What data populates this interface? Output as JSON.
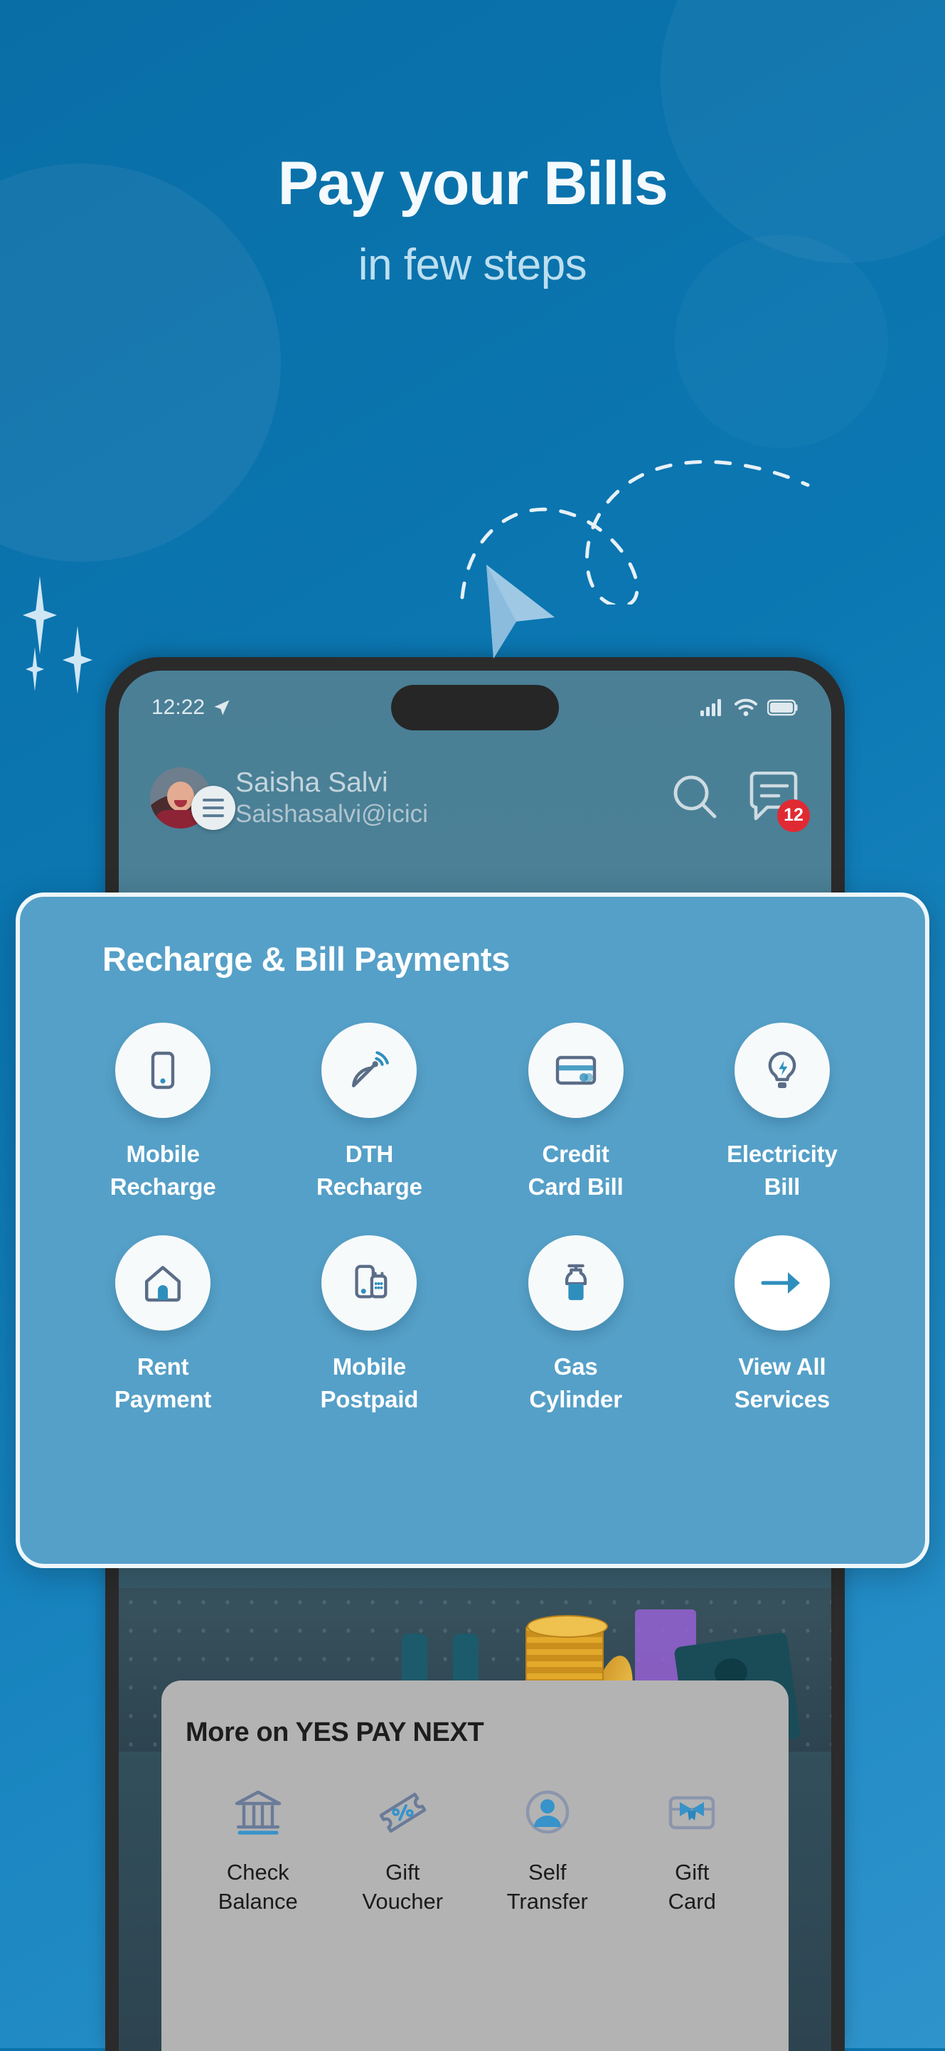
{
  "hero": {
    "headline": "Pay your Bills",
    "subhead": "in few steps"
  },
  "colors": {
    "background_top": "#0a6ea6",
    "background_bottom": "#2f93cb",
    "card_background": "#55a0c8",
    "card_border": "#eef7fc",
    "icon_circle": "#f7fafb",
    "icon_stroke": "#5a6d87",
    "icon_accent": "#2f8fbc",
    "badge_red": "#e02a33",
    "panel_grey": "#b3b3b3"
  },
  "phone": {
    "status_bar": {
      "time": "12:22",
      "location_icon": "location-arrow-icon",
      "signal_icon": "cellular-signal-icon",
      "wifi_icon": "wifi-icon",
      "battery_icon": "battery-icon"
    },
    "header": {
      "avatar": "user-avatar",
      "menu_icon": "hamburger-menu-icon",
      "user_name": "Saisha Salvi",
      "user_handle": "Saishasalvi@icici",
      "search_icon": "search-icon",
      "chat_icon": "chat-icon",
      "chat_badge": "12"
    }
  },
  "highlight_card": {
    "title": "Recharge & Bill Payments",
    "services": [
      {
        "label": "Mobile\nRecharge",
        "line1": "Mobile",
        "line2": "Recharge",
        "icon": "mobile-phone-icon"
      },
      {
        "label": "DTH\nRecharge",
        "line1": "DTH",
        "line2": "Recharge",
        "icon": "satellite-dish-icon"
      },
      {
        "label": "Credit\nCard Bill",
        "line1": "Credit",
        "line2": "Card Bill",
        "icon": "credit-card-icon"
      },
      {
        "label": "Electricity\nBill",
        "line1": "Electricity",
        "line2": "Bill",
        "icon": "lightbulb-icon"
      },
      {
        "label": "Rent\nPayment",
        "line1": "Rent",
        "line2": "Payment",
        "icon": "house-icon"
      },
      {
        "label": "Mobile\nPostpaid",
        "line1": "Mobile",
        "line2": "Postpaid",
        "icon": "two-phones-icon"
      },
      {
        "label": "Gas\nCylinder",
        "line1": "Gas",
        "line2": "Cylinder",
        "icon": "gas-cylinder-icon"
      },
      {
        "label": "View All\nServices",
        "line1": "View All",
        "line2": "Services",
        "icon": "arrow-right-icon"
      }
    ]
  },
  "more_panel": {
    "title": "More on YES PAY NEXT",
    "items": [
      {
        "line1": "Check",
        "line2": "Balance",
        "icon": "bank-icon"
      },
      {
        "line1": "Gift",
        "line2": "Voucher",
        "icon": "percent-ticket-icon"
      },
      {
        "line1": "Self",
        "line2": "Transfer",
        "icon": "person-circle-icon"
      },
      {
        "line1": "Gift",
        "line2": "Card",
        "icon": "gift-card-icon"
      }
    ]
  }
}
